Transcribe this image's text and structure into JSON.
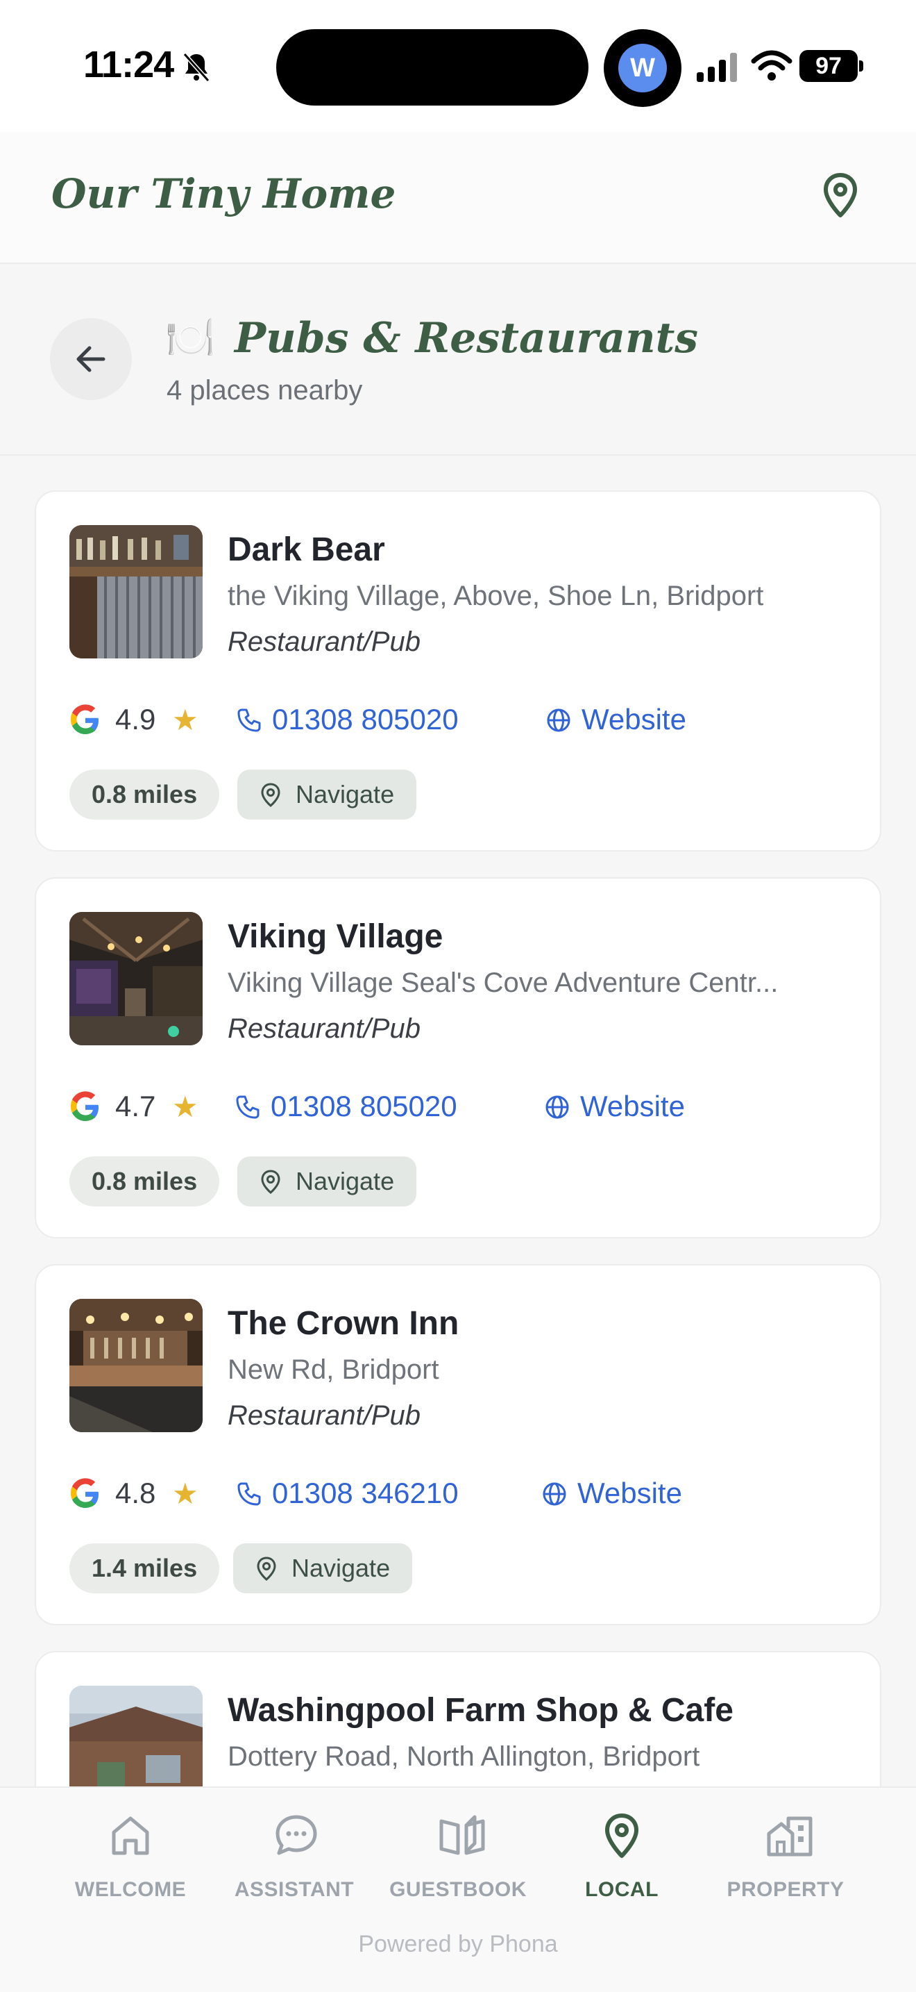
{
  "status_bar": {
    "time": "11:24",
    "avatar_letter": "W",
    "battery": "97"
  },
  "header": {
    "title": "Our Tiny Home",
    "location_icon": "map-pin-icon"
  },
  "section": {
    "emoji": "🍽️",
    "title": "Pubs & Restaurants",
    "subtitle": "4 places nearby"
  },
  "places": [
    {
      "name": "Dark Bear",
      "address": "the Viking Village, Above, Shoe Ln, Bridport",
      "category": "Restaurant/Pub",
      "rating": "4.9",
      "phone": "01308 805020",
      "website_label": "Website",
      "distance": "0.8 miles",
      "navigate_label": "Navigate"
    },
    {
      "name": "Viking Village",
      "address": "Viking Village Seal's Cove Adventure Centr...",
      "category": "Restaurant/Pub",
      "rating": "4.7",
      "phone": "01308 805020",
      "website_label": "Website",
      "distance": "0.8 miles",
      "navigate_label": "Navigate"
    },
    {
      "name": "The Crown Inn",
      "address": "New Rd, Bridport",
      "category": "Restaurant/Pub",
      "rating": "4.8",
      "phone": "01308 346210",
      "website_label": "Website",
      "distance": "1.4 miles",
      "navigate_label": "Navigate"
    },
    {
      "name": "Washingpool Farm Shop & Cafe",
      "address": "Dottery Road, North Allington, Bridport"
    }
  ],
  "star_glyph": "★",
  "bottom_nav": {
    "items": [
      {
        "label": "WELCOME",
        "icon": "home-icon"
      },
      {
        "label": "ASSISTANT",
        "icon": "chat-icon"
      },
      {
        "label": "GUESTBOOK",
        "icon": "book-icon"
      },
      {
        "label": "LOCAL",
        "icon": "map-pin-icon",
        "active": true
      },
      {
        "label": "PROPERTY",
        "icon": "building-icon"
      }
    ],
    "powered_by": "Powered by Phona"
  },
  "colors": {
    "brand_green": "#3d5e45",
    "link_blue": "#2f63d6",
    "star_gold": "#e7b431"
  }
}
